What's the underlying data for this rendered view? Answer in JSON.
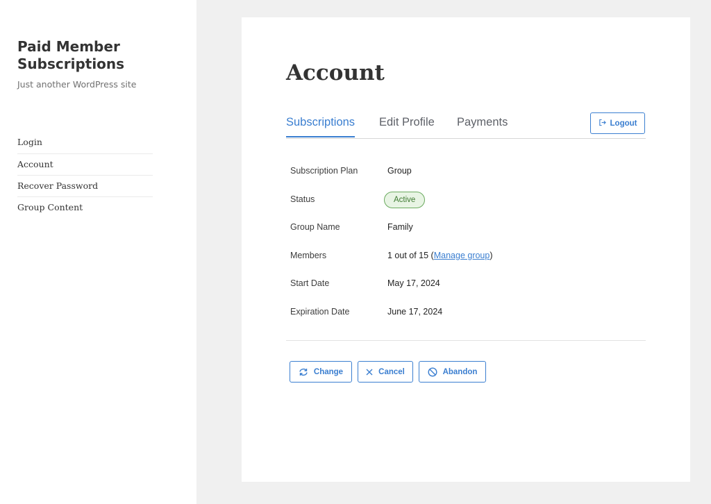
{
  "site": {
    "title": "Paid Member Subscriptions",
    "tagline": "Just another WordPress site"
  },
  "sidebar": {
    "items": [
      {
        "label": "Login"
      },
      {
        "label": "Account"
      },
      {
        "label": "Recover Password"
      },
      {
        "label": "Group Content"
      }
    ]
  },
  "main": {
    "title": "Account",
    "tabs": [
      {
        "label": "Subscriptions",
        "active": true
      },
      {
        "label": "Edit Profile",
        "active": false
      },
      {
        "label": "Payments",
        "active": false
      }
    ],
    "logout_label": "Logout",
    "details": {
      "plan_label": "Subscription Plan",
      "plan_value": "Group",
      "status_label": "Status",
      "status_value": "Active",
      "group_name_label": "Group Name",
      "group_name_value": "Family",
      "members_label": "Members",
      "members_count": "1 out of 15",
      "members_link": "Manage group",
      "start_label": "Start Date",
      "start_value": "May 17, 2024",
      "expiration_label": "Expiration Date",
      "expiration_value": "June 17, 2024"
    },
    "actions": {
      "change_label": "Change",
      "cancel_label": "Cancel",
      "abandon_label": "Abandon"
    }
  },
  "colors": {
    "accent": "#3a7ed0",
    "status_active_bg": "#e8f4e4",
    "status_active_border": "#6aaa5e",
    "page_bg": "#f0f0f0"
  },
  "icons": {
    "logout": "logout-icon",
    "change": "refresh-icon",
    "cancel": "close-icon",
    "abandon": "block-icon"
  }
}
